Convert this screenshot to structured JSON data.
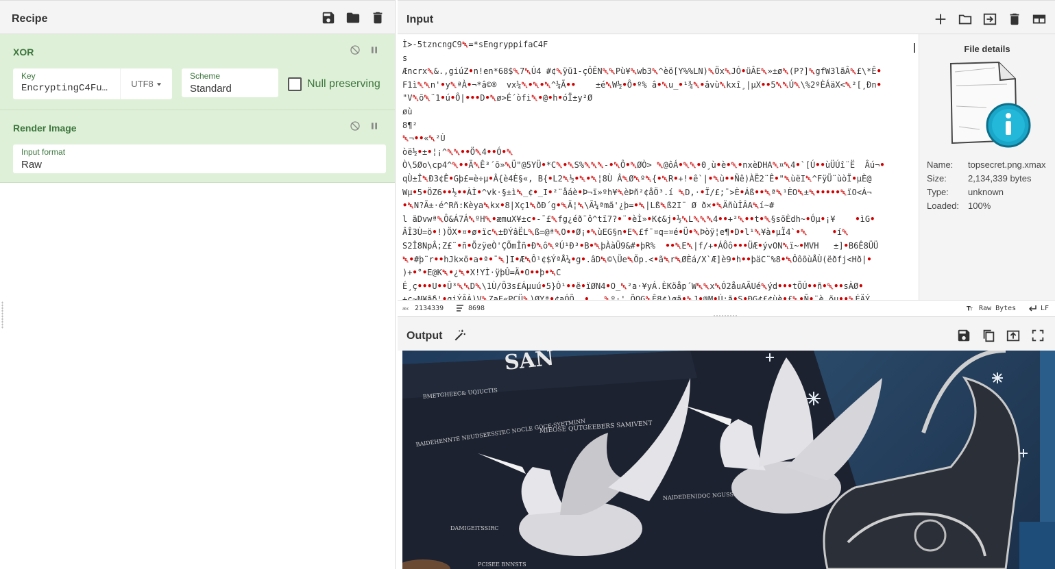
{
  "recipe": {
    "title": "Recipe",
    "operations": {
      "xor": {
        "title": "XOR",
        "key": {
          "label": "Key",
          "value": "EncryptingC4Fu…",
          "encoding": "UTF8"
        },
        "scheme": {
          "label": "Scheme",
          "value": "Standard"
        },
        "null_preserving": {
          "label": "Null preserving",
          "checked": false
        }
      },
      "render_image": {
        "title": "Render Image",
        "input_format": {
          "label": "Input format",
          "value": "Raw"
        }
      }
    }
  },
  "input": {
    "title": "Input",
    "text_lines": [
      "Ì>-5tzncngC9␡=*sEngryppifaC4F",
      "s",
      "Æncrx␡&.,giúZ•n!en*68$␡7␡Ú4 #¢␡ÿü1-çÔÊN␡␡Pù¥␡wb3␡^èö[Y%%LN)␡Öx␡JÓ•üÂE␡»±ø␡(P?]␡gfW3lãÂ␡£\\*Ê•",
      "F1ì␡␡n'•y␡ªÀ•¬*â©®  vx¼␡•␡•␡^¼Ã••    ±é␡W½•Ô•º% â•␡u_•¹¾␡•âvù␡kxî¸|µX••5␡␡Ú␡\\%2ºÈÁäX<␡²[¸Ðn•",
      "\"V␡õ␡¨1•ú•Ô|•••D•␡ø>É´òfi␡•@•h•óÏ±y²Ø",
      "øù",
      "8¶²",
      "␡¬••«␡²Ù",
      "òë½•±•¦¡^␡␡••Ö␡4••Ó•␡",
      "Ò\\5Øo\\cp4^␡••Ä␡Ê³´õ»␡Ü\"@5YÜ•*C␡•␡S%␡␡␡-•␡Ô•␡ØÒ> ␡@ôÁ•␡␡•0¸ù•è•␡•nxèDHA␡¤␡4•`[Ú••ùÜÚî¨Ë  Âú¬•",
      "qÙ±Î␡Ð3¢Ê•Gþ£=è÷µ•Â{è4È§«, B{•L2␡½•␡•␡¦8Ù Â␡Ø␡º␡{•␡R•+!•ê`|•␡ù••Ñê)ÀË2¨Ê•\"␡ùëI␡^FÿÜ¨ùòÏ•µÈ@",
      "Wµ•5•ÖZ6••½••ÀÌ•^vk·§±ì␡_¢•_I•²¨åáè•Þ¬ï»ºh¥␡èÞñ²¢åÖ³.í ␡D,·•Ï/£;¯>È•Áß••␡ª␡¹ÈO␡±␡•••••␡ïO<Á¬",
      "•␡N?Ã±·é^Rñ:Kèya␡kx•8|Xç1␡ðÐ´g•␡Ã¦␡\\Ã¼ªmã'¿þ=•␡|Lß␡ß2I¨ Ø ð×•␡ÄñùÎÂA␡í~#",
      "l äDvwª␡Ô&Á7Á␡ºH␡•æmuX¥±c•-¯£␡fg¿éð¨ô^tï7?•¨•èÌ»•K¢&j•½␡L␡␡␡4••+²␡••t•␡§sõÈdh~•Óµ•¡¥    •ìG•",
      "ÂÎ3Ù=ö•!)ÖX•¤•ø•ïc␡±ÐÝâËL␡ß=@ª␡O••Ø¡•␡ùEG§n•E␡£f¨¤q=¤é•Ü•␡Þòÿ¦e¶•D•l¹␡¥à•µÏ4`•␡     •í␡",
      "S2Î8NpÂ;Z£¨•ñ•ÕzÿeÒ'ÇÕmÎñ•Ð␡ô␡ºÚ¹Ð³•B•␡þÀàÜ9&#•þR%  ••␡E␡|f/+•ÁÔô•••ÜÆ•ývON␡ï~•MVH   ±]•B6Ê8ÜÜ",
      "␡•#þ¨r••hJk×ö•a•ª•¯␡]I•Æ␡Ô¹¢$ÝªÅ¼•g•.âD␡©\\Üe␡Õp.<•ã␡r␡ØÈá/X`Æ]è9•h••þäC¨%8•␡ÔôõùÅÙ(ëðfj<Hð|•",
      ")+•°•E@K␡•¿␡•X!YÌ·ÿþÛ=Ä•O••þ•␡C",
      "É¸ç•••U••Û³␡␡D␡\\1Ù/Õ3s£Áµuú•5}Ò¹••ë•ïØN4•O_␡²a·¥yÁ.ÈKöåp´W␡␡x␡Ó2åuAÃUé␡ýd•••tÕÚ••ñ•␡••sÀØ•",
      "+ç~N¥ãδ¦•qiÝÂÀ)V␡ZaE«PCÜ␡)ØYª•¢aÓÕ  •   ␡º·' ÖQG␡Ê8¢)øä•␡J•®M•Ú:ã•S•ÐG¢£¢ùè•£␡•Ñ•¨è¸õu••␡ÉÄÝ"
    ],
    "file_details": {
      "title": "File details",
      "rows": [
        {
          "label": "Name:",
          "value": "topsecret.png.xmax"
        },
        {
          "label": "Size:",
          "value": "2,134,339 bytes"
        },
        {
          "label": "Type:",
          "value": "unknown"
        },
        {
          "label": "Loaded:",
          "value": "100%"
        }
      ]
    },
    "status": {
      "length": "2134339",
      "lines": "8698",
      "encoding": "Raw Bytes",
      "eol": "LF"
    }
  },
  "output": {
    "title": "Output",
    "image": {
      "description_icon": "rendered-image",
      "visible_text": [
        "SAN",
        "BMETGHEEC& UQIUCTIS",
        "MIEOSE QUTGEEBERS SAMIVENT",
        "BAIDEHENNTE NEUDSEESSTEC NOCLE GOCE-SYETMINN",
        "NAIDEDENIDOC NGUSSIDSES",
        "DAMIGEITSSIRC",
        "PCISEE BNNSTS"
      ]
    }
  },
  "colors": {
    "op_bg": "#dff0d8",
    "op_text": "#3c763d",
    "nonprint_red": "#d00000",
    "accent_teal": "#1aa6c8"
  }
}
